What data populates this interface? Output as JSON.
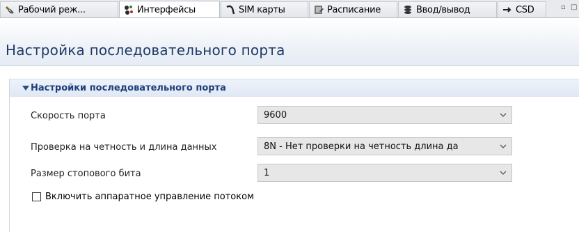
{
  "tabs": [
    {
      "label": "Рабочий реж...",
      "icon": "plug-icon"
    },
    {
      "label": "Интерфейсы",
      "icon": "interfaces-icon",
      "active": true
    },
    {
      "label": "SIM карты",
      "icon": "sim-icon"
    },
    {
      "label": "Расписание",
      "icon": "schedule-icon"
    },
    {
      "label": "Ввод/вывод",
      "icon": "io-icon"
    },
    {
      "label": "CSD",
      "icon": "arrow-right-icon"
    }
  ],
  "header": {
    "title": "Настройка последовательного порта"
  },
  "section": {
    "title": "Настройки последовательного порта"
  },
  "fields": {
    "port_speed": {
      "label": "Скорость порта",
      "value": "9600"
    },
    "parity": {
      "label": "Проверка на четность и длина данных",
      "value": "8N - Нет проверки на четность длина да"
    },
    "stop_bits": {
      "label": "Размер стопового бита",
      "value": "1"
    }
  },
  "flow_control": {
    "label": "Включить аппаратное управление потоком",
    "checked": false
  },
  "colors": {
    "title": "#1f3a66",
    "section": "#1f3f7a",
    "combo_bg": "#e7e7e7"
  }
}
